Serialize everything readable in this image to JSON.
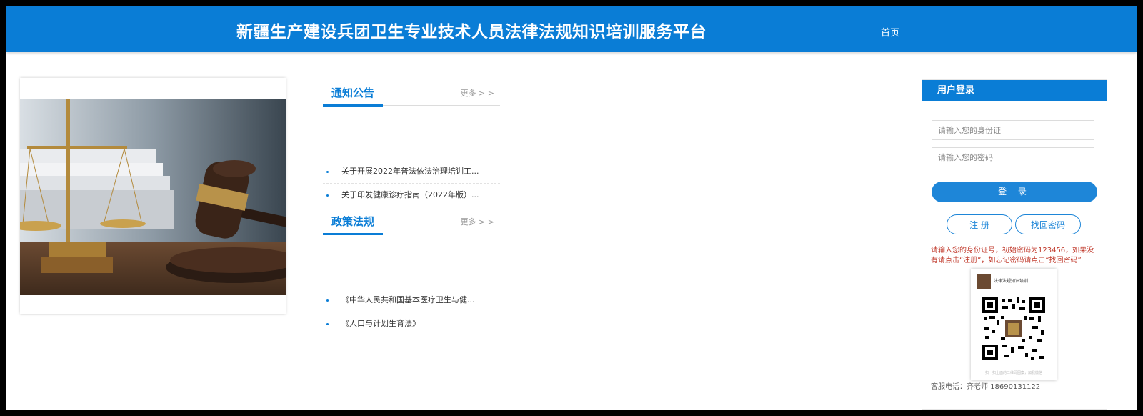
{
  "header": {
    "title": "新疆生产建设兵团卫生专业技术人员法律法规知识培训服务平台",
    "home_label": "首页"
  },
  "notices": {
    "title": "通知公告",
    "more": "更多 > >",
    "items": [
      "关于开展2022年普法依法治理培训工...",
      "关于印发健康诊疗指南（2022年版）..."
    ]
  },
  "policies": {
    "title": "政策法规",
    "more": "更多 > >",
    "items": [
      "《中华人民共和国基本医疗卫生与健...",
      "《人口与计划生育法》"
    ]
  },
  "login": {
    "title": "用户登录",
    "id_placeholder": "请输入您的身份证",
    "pwd_placeholder": "请输入您的密码",
    "login_label": "登 录",
    "register_label": "注 册",
    "recover_label": "找回密码",
    "tip": "请输入您的身份证号，初始密码为123456，如果没有请点击“注册”，如忘记密码请点击“找回密码”",
    "qr_caption": "法律法规知识培训 ",
    "qr_footer": "扫一扫上面的二维码图案，加我微信",
    "contact": "客服电话：齐老师 18690131122"
  },
  "colors": {
    "primary": "#0a7dd6",
    "tip": "#c0392b"
  }
}
